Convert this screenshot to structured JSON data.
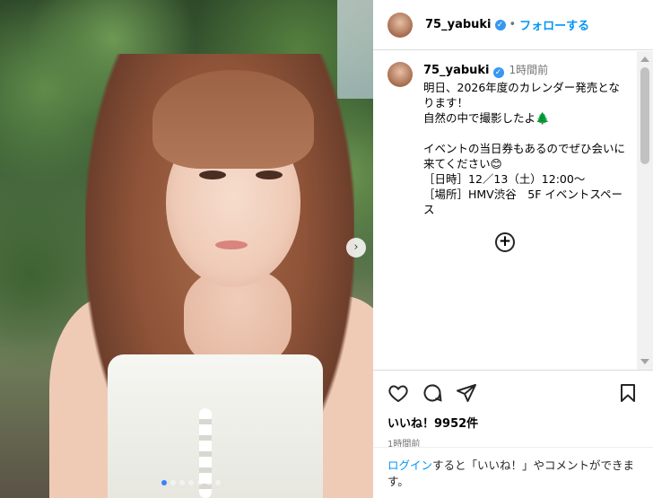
{
  "post": {
    "username": "75_yabuki",
    "follow_label": "フォローする",
    "caption_time": "1時間前",
    "caption": "明日、2026年度のカレンダー発売となります！\n自然の中で撮影したよ🌲\n\nイベントの当日券もあるのでぜひ会いに来てください😊\n［日時］12／13（土）12:00〜\n［場所］HMV渋谷　5F イベントスペース",
    "load_more_icon": "plus-circle-icon",
    "likes": "いいね！9952件",
    "time_ago": "1時間前"
  },
  "login": {
    "link": "ログイン",
    "rest": "すると「いいね！」やコメントができます。"
  },
  "carousel": {
    "slides": 7,
    "active_slide": 1
  },
  "colors": {
    "link": "#0095f6",
    "verified": "#3897f0",
    "muted": "#737373"
  }
}
